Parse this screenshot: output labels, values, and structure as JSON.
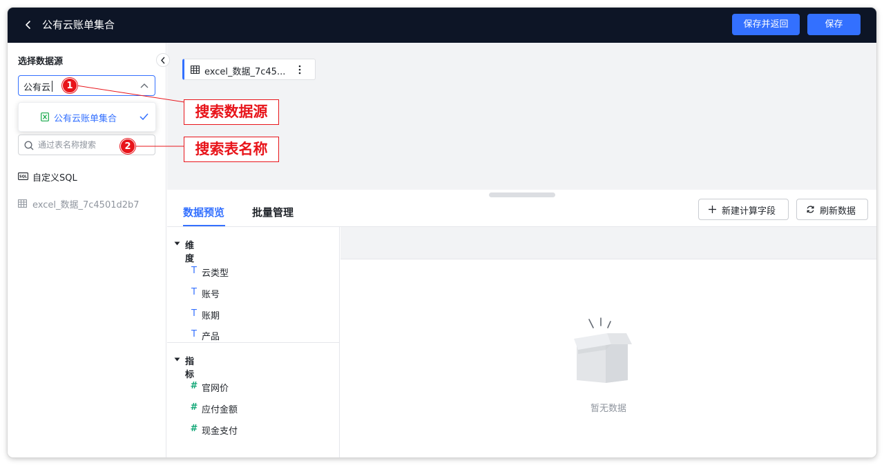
{
  "header": {
    "title": "公有云账单集合",
    "save_and_return": "保存并返回",
    "save": "保存"
  },
  "sidebar": {
    "title": "选择数据源",
    "datasource_query": "公有云",
    "datasource_option": "公有云账单集合",
    "table_search_placeholder": "通过表名称搜索",
    "items": [
      {
        "label": "自定义SQL",
        "icon": "sql-icon"
      },
      {
        "label": "excel_数据_7c4501d2b7",
        "icon": "table-icon"
      }
    ]
  },
  "canvas": {
    "table_card_label": "excel_数据_7c45..."
  },
  "panel": {
    "tabs": [
      "数据预览",
      "批量管理"
    ],
    "new_field_button": "新建计算字段",
    "refresh_button": "刷新数据",
    "dimension_group": "维度",
    "dimensions": [
      {
        "type": "T",
        "name": "云类型"
      },
      {
        "type": "T",
        "name": "账号"
      },
      {
        "type": "T",
        "name": "账期"
      },
      {
        "type": "T",
        "name": "产品"
      }
    ],
    "metric_group": "指标",
    "metrics": [
      {
        "type": "#",
        "name": "官网价"
      },
      {
        "type": "#",
        "name": "应付金额"
      },
      {
        "type": "#",
        "name": "现金支付"
      }
    ],
    "empty_text": "暂无数据"
  },
  "annotations": [
    {
      "number": "1",
      "label": "搜索数据源"
    },
    {
      "number": "2",
      "label": "搜索表名称"
    }
  ],
  "colors": {
    "header_bg": "#0d1526",
    "primary": "#3370ff",
    "annotation_red": "#e8141a",
    "number_type": "#14a878"
  }
}
